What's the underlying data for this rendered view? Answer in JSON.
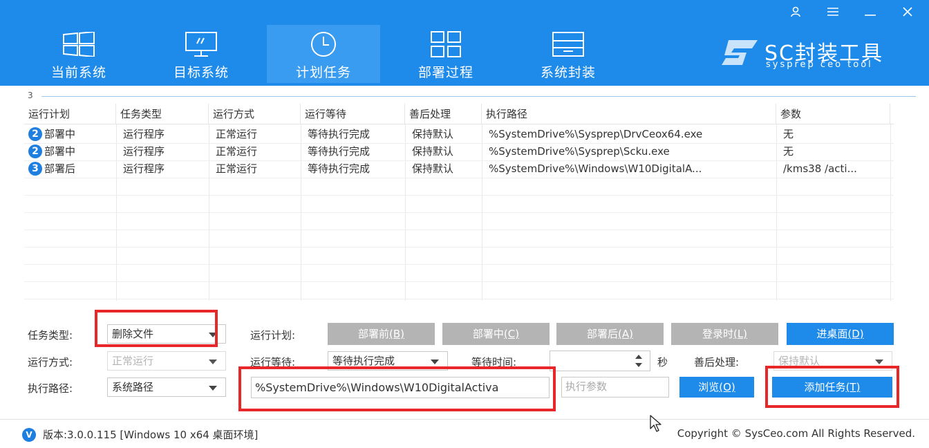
{
  "header": {
    "tabs": [
      {
        "label": "当前系统",
        "icon": "windows-icon"
      },
      {
        "label": "目标系统",
        "icon": "monitor-icon"
      },
      {
        "label": "计划任务",
        "icon": "clock-icon",
        "active": true
      },
      {
        "label": "部署过程",
        "icon": "grid-icon"
      },
      {
        "label": "系统封装",
        "icon": "drawer-icon"
      }
    ],
    "logo_text": "SC封装工具",
    "logo_sub": "sysprep ceo tool",
    "accent_color": "#1e8bea"
  },
  "table": {
    "count": "3",
    "columns": [
      "运行计划",
      "任务类型",
      "运行方式",
      "运行等待",
      "善后处理",
      "执行路径",
      "参数"
    ],
    "rows": [
      {
        "badge": "2",
        "plan": "部署中",
        "type": "运行程序",
        "mode": "正常运行",
        "wait": "等待执行完成",
        "after": "保持默认",
        "path": "%SystemDrive%\\Sysprep\\DrvCeox64.exe",
        "params": "无"
      },
      {
        "badge": "2",
        "plan": "部署中",
        "type": "运行程序",
        "mode": "正常运行",
        "wait": "等待执行完成",
        "after": "保持默认",
        "path": "%SystemDrive%\\Sysprep\\Scku.exe",
        "params": "无"
      },
      {
        "badge": "3",
        "plan": "部署后",
        "type": "运行程序",
        "mode": "正常运行",
        "wait": "等待执行完成",
        "after": "保持默认",
        "path": "%SystemDrive%\\Windows\\W10DigitalA...",
        "params": "/kms38 /acti..."
      }
    ]
  },
  "form": {
    "task_type_label": "任务类型:",
    "task_type_value": "删除文件",
    "run_mode_label": "运行方式:",
    "run_mode_value": "正常运行",
    "exec_path_label": "执行路径:",
    "exec_path_value": "系统路径",
    "schedule_label": "运行计划:",
    "schedule_buttons": [
      {
        "label": "部署前",
        "key": "(B)"
      },
      {
        "label": "部署中",
        "key": "(C)"
      },
      {
        "label": "部署后",
        "key": "(A)"
      },
      {
        "label": "登录时",
        "key": "(L)"
      },
      {
        "label": "进桌面",
        "key": "(D)"
      }
    ],
    "wait_label": "运行等待:",
    "wait_value": "等待执行完成",
    "wait_time_label": "等待时间:",
    "wait_time_value": "",
    "seconds_label": "秒",
    "after_label": "善后处理:",
    "after_value": "保持默认",
    "path_value": "%SystemDrive%\\Windows\\W10DigitalActiva",
    "params_placeholder": "执行参数",
    "browse_label": "浏览",
    "browse_key": "(O)",
    "add_task_label": "添加任务",
    "add_task_key": "(T)"
  },
  "footer": {
    "version_icon": "V",
    "version": "版本:3.0.0.115 [Windows 10 x64 桌面环境]",
    "copyright": "Copyright © SysCeo.com All Rights Reserved."
  }
}
